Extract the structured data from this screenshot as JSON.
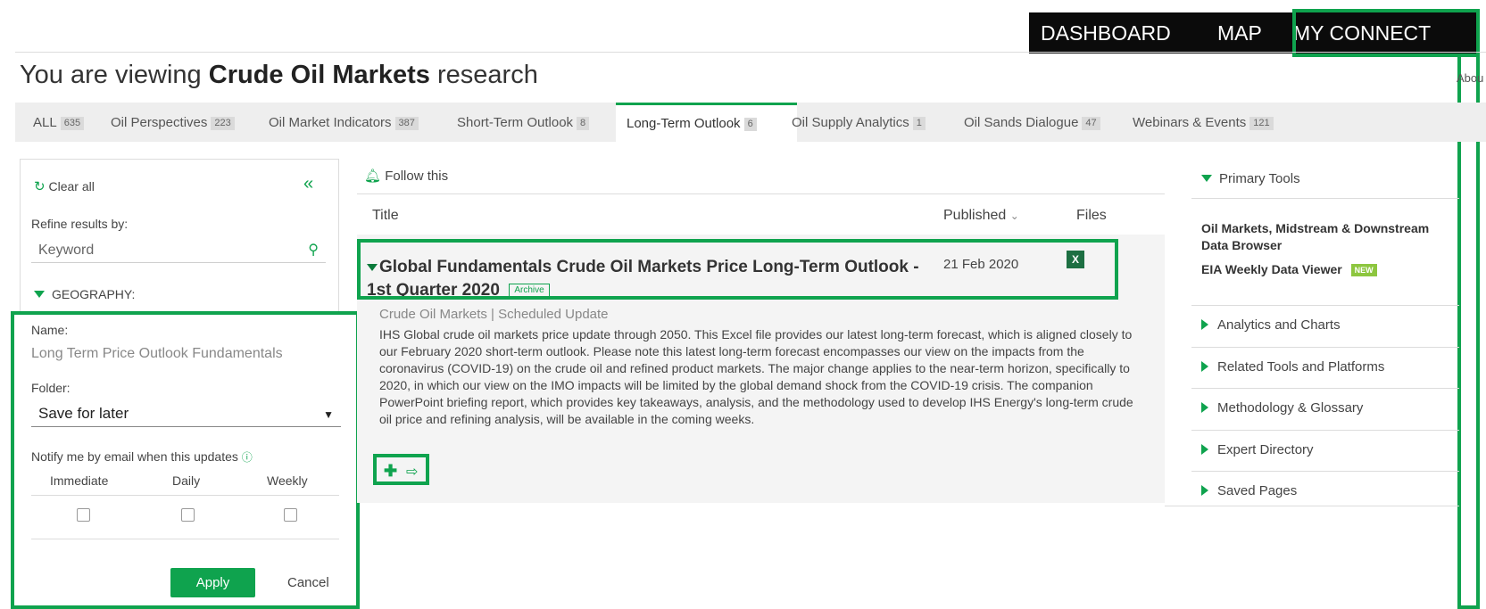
{
  "topnav": {
    "dashboard": "DASHBOARD",
    "map": "MAP",
    "my_connect": "MY CONNECT"
  },
  "header": {
    "prefix": "You are viewing ",
    "subject": "Crude Oil Markets",
    "suffix": " research",
    "about": "Abou"
  },
  "tabs": [
    {
      "label": "ALL",
      "count": "635"
    },
    {
      "label": "Oil Perspectives",
      "count": "223"
    },
    {
      "label": "Oil Market Indicators",
      "count": "387"
    },
    {
      "label": "Short-Term Outlook",
      "count": "8"
    },
    {
      "label": "Long-Term Outlook",
      "count": "6"
    },
    {
      "label": "Oil Supply Analytics",
      "count": "1"
    },
    {
      "label": "Oil Sands Dialogue",
      "count": "47"
    },
    {
      "label": "Webinars & Events",
      "count": "121"
    }
  ],
  "filters": {
    "clear_all": "Clear all",
    "collapse": "«",
    "refine": "Refine results by:",
    "keyword_placeholder": "Keyword",
    "geography": "GEOGRAPHY:"
  },
  "save_panel": {
    "name_label": "Name:",
    "name_value": "Long Term Price Outlook Fundamentals",
    "folder_label": "Folder:",
    "folder_value": "Save for later",
    "notify_label": "Notify me by email when this updates",
    "options": [
      "Immediate",
      "Daily",
      "Weekly"
    ],
    "apply": "Apply",
    "cancel": "Cancel"
  },
  "results": {
    "follow": "Follow this",
    "col_title": "Title",
    "col_published": "Published",
    "col_files": "Files",
    "item": {
      "title": "Global Fundamentals Crude Oil Markets Price Long-Term Outlook - 1st Quarter 2020",
      "badge": "Archive",
      "date": "21 Feb 2020",
      "file_icon": "X",
      "meta": "Crude Oil Markets | Scheduled Update",
      "description": "IHS Global crude oil markets price update through 2050. This Excel file provides our latest long-term forecast, which is aligned closely to our February 2020 short-term outlook. Please note this latest long-term forecast encompasses our view on the impacts from the coronavirus (COVID-19) on the crude oil and refined product markets. The major change applies to the near-term horizon, specifically to 2020, in which our view on the IMO impacts will be limited by the global demand shock from the COVID-19 crisis. The companion PowerPoint briefing report, which provides key takeaways, analysis, and the methodology used to develop IHS Energy's long-term crude oil price and refining analysis, will be available in the coming weeks."
    }
  },
  "sidebar": {
    "primary_tools": "Primary Tools",
    "tool1": "Oil Markets, Midstream & Downstream Data Browser",
    "tool2": "EIA Weekly Data Viewer",
    "new_badge": "NEW",
    "sections": [
      "Analytics and Charts",
      "Related Tools and Platforms",
      "Methodology & Glossary",
      "Expert Directory",
      "Saved Pages"
    ]
  },
  "colors": {
    "accent": "#0fa34e",
    "nav_bg": "#0b0b0b"
  }
}
